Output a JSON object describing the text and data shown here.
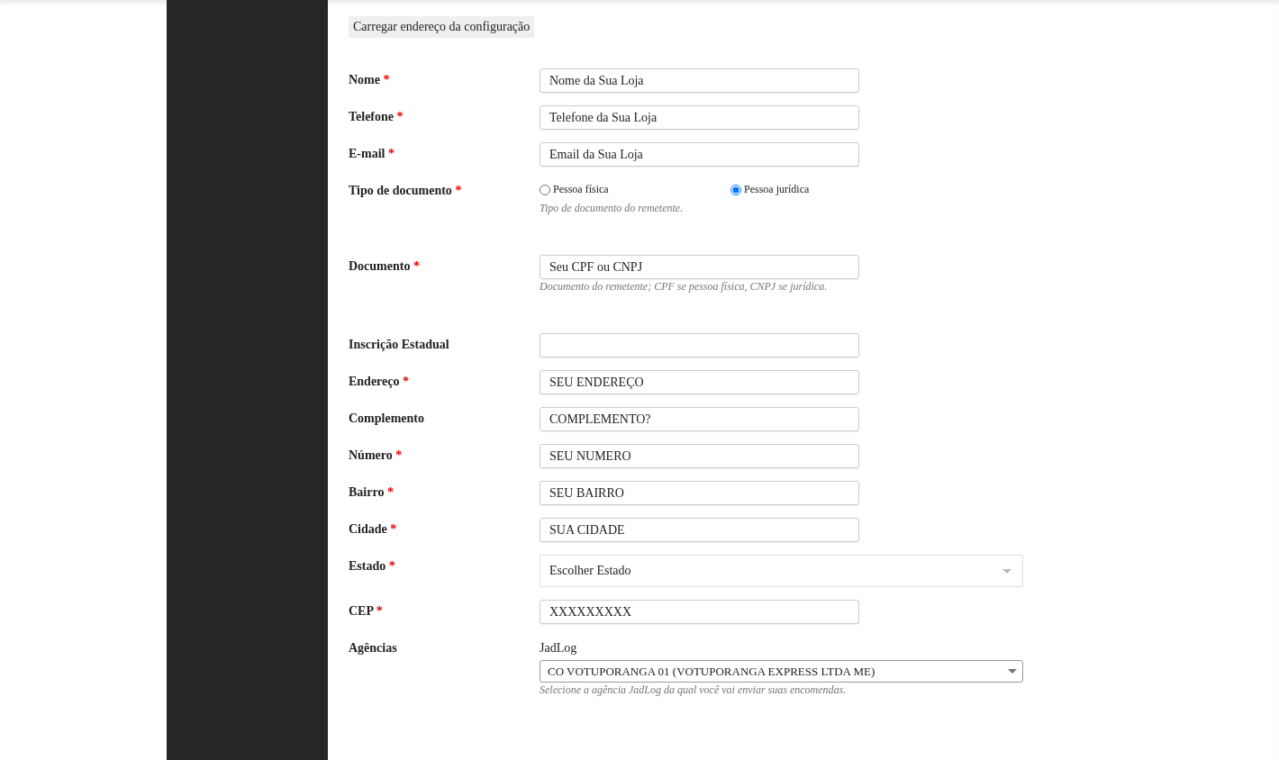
{
  "load_button": {
    "label": "Carregar endereço da configuração"
  },
  "fields": [
    {
      "kind": "text",
      "label": "Nome",
      "required_mark": "*",
      "value": "Nome da Sua Loja"
    },
    {
      "kind": "text",
      "label": "Telefone",
      "required_mark": "*",
      "value": "Telefone da Sua Loja"
    },
    {
      "kind": "text",
      "label": "E-mail",
      "required_mark": "*",
      "value": "Email da Sua Loja"
    },
    {
      "kind": "radio",
      "label": "Tipo de documento",
      "required_mark": "*",
      "options": [
        {
          "label": "Pessoa física",
          "selected": false
        },
        {
          "label": "Pessoa jurídica",
          "selected": true
        }
      ],
      "hint": "Tipo de documento do remetente."
    },
    {
      "kind": "text",
      "label": "Documento",
      "required_mark": "*",
      "value": "Seu CPF ou CNPJ",
      "hint": "Documento do remetente; CPF se pessoa física, CNPJ se jurídica."
    },
    {
      "kind": "text",
      "label": "Inscrição Estadual"
    },
    {
      "kind": "text",
      "label": "Endereço",
      "required_mark": "*",
      "value": "SEU ENDEREÇO"
    },
    {
      "kind": "text",
      "label": "Complemento",
      "value": "COMPLEMENTO?"
    },
    {
      "kind": "text",
      "label": "Número",
      "required_mark": "*",
      "value": "SEU NUMERO"
    },
    {
      "kind": "text",
      "label": "Bairro",
      "required_mark": "*",
      "value": "SEU BAIRRO"
    },
    {
      "kind": "text",
      "label": "Cidade",
      "required_mark": "*",
      "value": "SUA CIDADE"
    },
    {
      "kind": "select",
      "label": "Estado",
      "required_mark": "*",
      "value": "Escolher Estado"
    },
    {
      "kind": "text",
      "label": "CEP",
      "required_mark": "*",
      "value": "XXXXXXXXX"
    },
    {
      "kind": "agency",
      "label": "Agências",
      "carrier": "JadLog",
      "value": "CO VOTUPORANGA 01 (VOTUPORANGA EXPRESS LTDA ME)",
      "hint": "Selecione a agência JadLog da qual você vai enviar suas encomendas."
    }
  ]
}
